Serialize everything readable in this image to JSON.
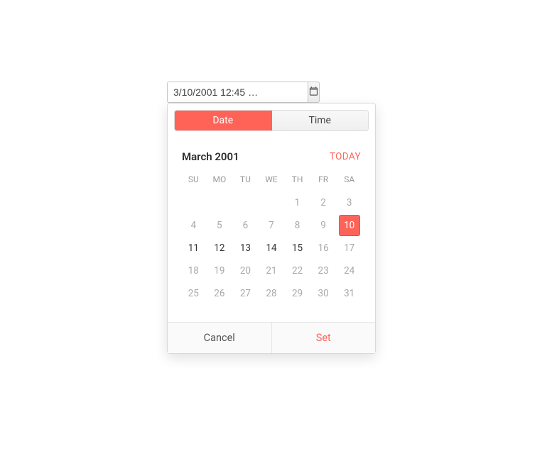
{
  "input": {
    "value": "3/10/2001 12:45 …"
  },
  "tabs": {
    "date": "Date",
    "time": "Time"
  },
  "calendar": {
    "title": "March 2001",
    "today_label": "TODAY",
    "weekdays": [
      "SU",
      "MO",
      "TU",
      "WE",
      "TH",
      "FR",
      "SA"
    ],
    "selected_day": 10,
    "cells": [
      {
        "n": "",
        "muted": false
      },
      {
        "n": "",
        "muted": false
      },
      {
        "n": "",
        "muted": false
      },
      {
        "n": "",
        "muted": false
      },
      {
        "n": "1",
        "muted": true
      },
      {
        "n": "2",
        "muted": true
      },
      {
        "n": "3",
        "muted": true
      },
      {
        "n": "4",
        "muted": true
      },
      {
        "n": "5",
        "muted": true
      },
      {
        "n": "6",
        "muted": true
      },
      {
        "n": "7",
        "muted": true
      },
      {
        "n": "8",
        "muted": true
      },
      {
        "n": "9",
        "muted": true
      },
      {
        "n": "10",
        "muted": false,
        "selected": true
      },
      {
        "n": "11",
        "muted": false
      },
      {
        "n": "12",
        "muted": false
      },
      {
        "n": "13",
        "muted": false
      },
      {
        "n": "14",
        "muted": false
      },
      {
        "n": "15",
        "muted": false
      },
      {
        "n": "16",
        "muted": true
      },
      {
        "n": "17",
        "muted": true
      },
      {
        "n": "18",
        "muted": true
      },
      {
        "n": "19",
        "muted": true
      },
      {
        "n": "20",
        "muted": true
      },
      {
        "n": "21",
        "muted": true
      },
      {
        "n": "22",
        "muted": true
      },
      {
        "n": "23",
        "muted": true
      },
      {
        "n": "24",
        "muted": true
      },
      {
        "n": "25",
        "muted": true
      },
      {
        "n": "26",
        "muted": true
      },
      {
        "n": "27",
        "muted": true
      },
      {
        "n": "28",
        "muted": true
      },
      {
        "n": "29",
        "muted": true
      },
      {
        "n": "30",
        "muted": true
      },
      {
        "n": "31",
        "muted": true
      }
    ]
  },
  "footer": {
    "cancel": "Cancel",
    "set": "Set"
  },
  "colors": {
    "accent": "#ff6358"
  }
}
